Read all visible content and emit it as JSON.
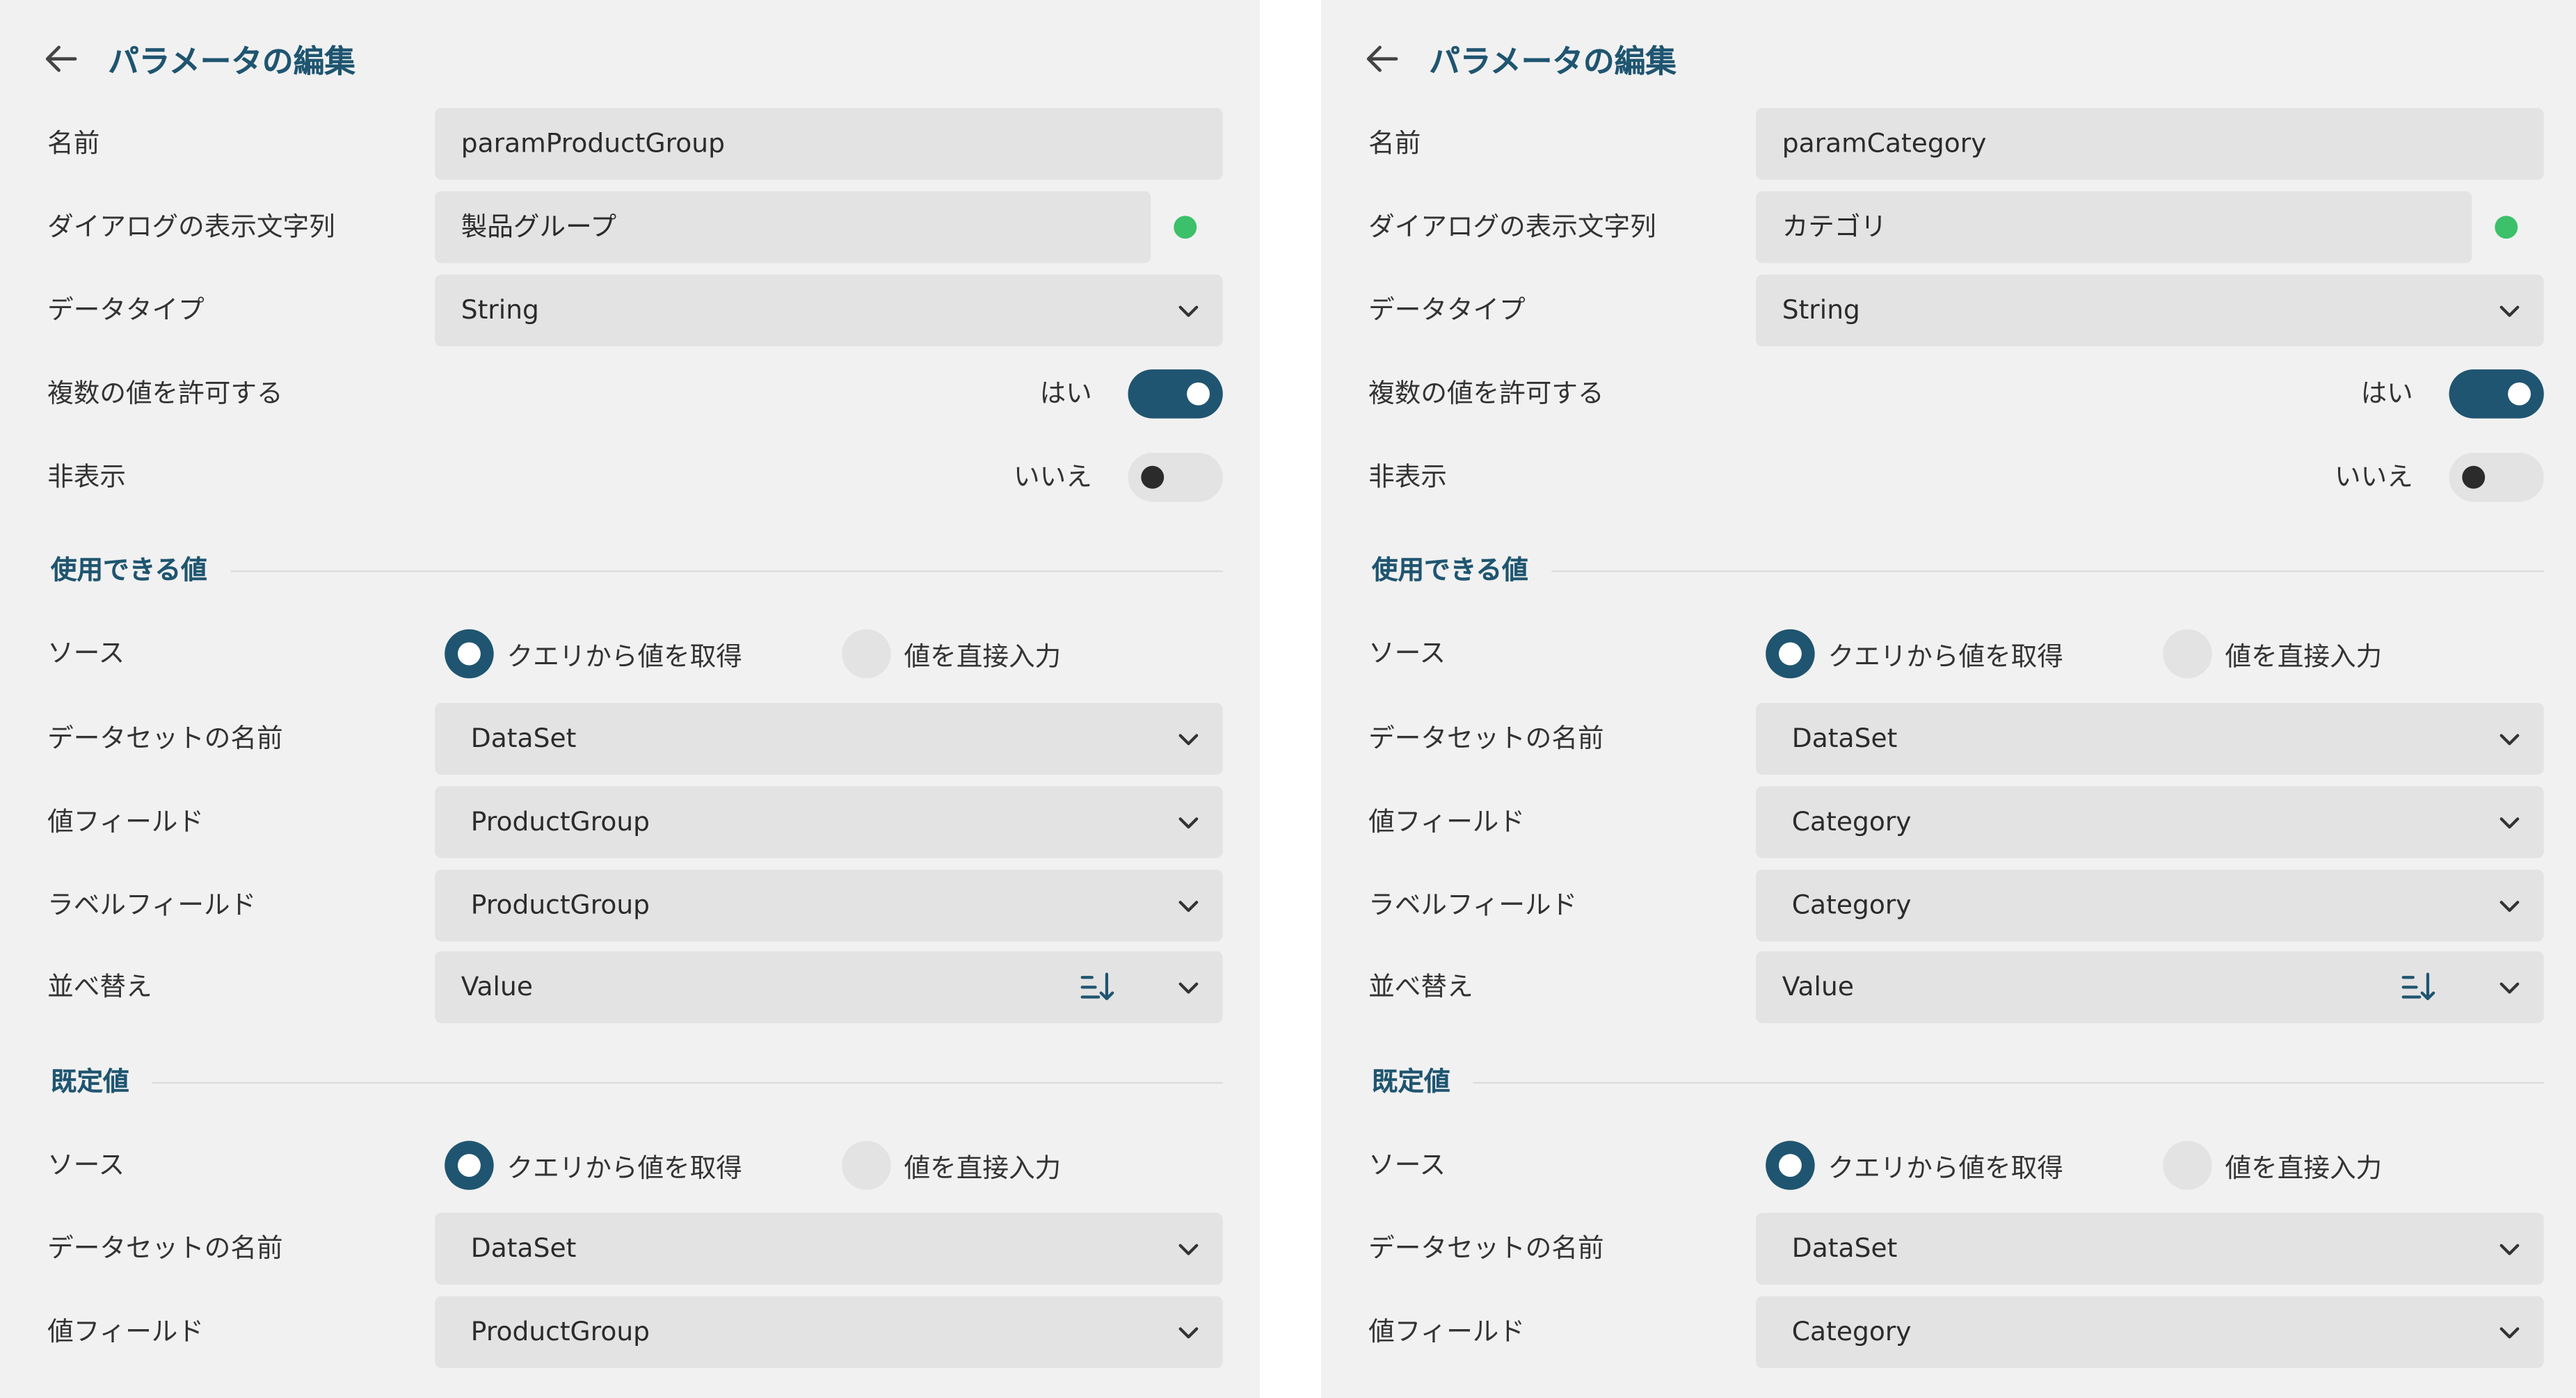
{
  "panels": [
    {
      "title": "パラメータの編集",
      "name_label": "名前",
      "name_value": "paramProductGroup",
      "prompt_label": "ダイアログの表示文字列",
      "prompt_value": "製品グループ",
      "datatype_label": "データタイプ",
      "datatype_value": "String",
      "multi_label": "複数の値を許可する",
      "multi_state": "はい",
      "hidden_label": "非表示",
      "hidden_state": "いいえ",
      "available_title": "使用できる値",
      "available": {
        "source_label": "ソース",
        "source_query": "クエリから値を取得",
        "source_manual": "値を直接入力",
        "dataset_label": "データセットの名前",
        "dataset_value": "DataSet",
        "value_field_label": "値フィールド",
        "value_field_value": "ProductGroup",
        "label_field_label": "ラベルフィールド",
        "label_field_value": "ProductGroup",
        "sort_label": "並べ替え",
        "sort_value": "Value"
      },
      "default_title": "既定値",
      "default": {
        "source_label": "ソース",
        "source_query": "クエリから値を取得",
        "source_manual": "値を直接入力",
        "dataset_label": "データセットの名前",
        "dataset_value": "DataSet",
        "value_field_label": "値フィールド",
        "value_field_value": "ProductGroup"
      }
    },
    {
      "title": "パラメータの編集",
      "name_label": "名前",
      "name_value": "paramCategory",
      "prompt_label": "ダイアログの表示文字列",
      "prompt_value": "カテゴリ",
      "datatype_label": "データタイプ",
      "datatype_value": "String",
      "multi_label": "複数の値を許可する",
      "multi_state": "はい",
      "hidden_label": "非表示",
      "hidden_state": "いいえ",
      "available_title": "使用できる値",
      "available": {
        "source_label": "ソース",
        "source_query": "クエリから値を取得",
        "source_manual": "値を直接入力",
        "dataset_label": "データセットの名前",
        "dataset_value": "DataSet",
        "value_field_label": "値フィールド",
        "value_field_value": "Category",
        "label_field_label": "ラベルフィールド",
        "label_field_value": "Category",
        "sort_label": "並べ替え",
        "sort_value": "Value"
      },
      "default_title": "既定値",
      "default": {
        "source_label": "ソース",
        "source_query": "クエリから値を取得",
        "source_manual": "値を直接入力",
        "dataset_label": "データセットの名前",
        "dataset_value": "DataSet",
        "value_field_label": "値フィールド",
        "value_field_value": "Category"
      }
    }
  ],
  "colors": {
    "accent": "#1f5570",
    "panel_bg": "#f1f1f1",
    "field_bg": "#e3e3e3",
    "status_green": "#3cc06a"
  },
  "icons": {
    "back": "arrow-left-icon",
    "dropdown": "chevron-down-icon",
    "sort": "sort-ascending-icon"
  }
}
